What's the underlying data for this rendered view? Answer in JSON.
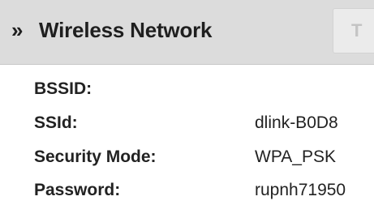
{
  "header": {
    "collapse_glyph": "»",
    "title": "Wireless Network",
    "tab_partial_label": "T"
  },
  "fields": [
    {
      "label": "BSSID:",
      "value": ""
    },
    {
      "label": "SSId:",
      "value": "dlink-B0D8"
    },
    {
      "label": "Security Mode:",
      "value": "WPA_PSK"
    },
    {
      "label": "Password:",
      "value": "rupnh71950"
    }
  ],
  "colors": {
    "header_background": "#dcdcdc",
    "page_background": "#ffffff",
    "text": "#222222"
  },
  "icons": {
    "collapse": "double-chevron-right-icon"
  }
}
